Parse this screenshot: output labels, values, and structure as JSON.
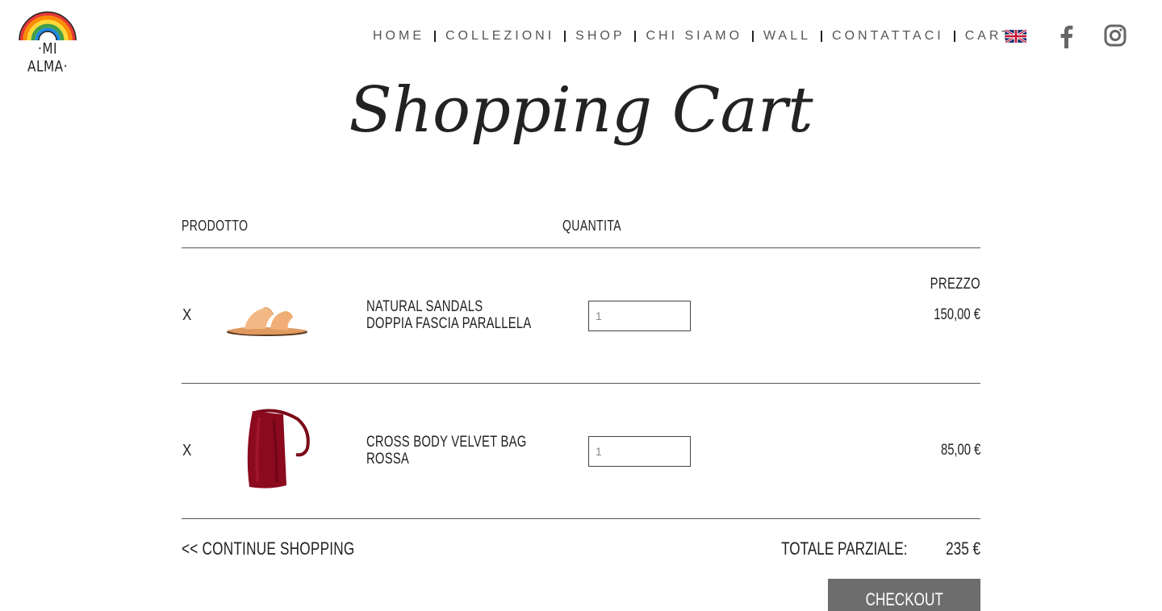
{
  "brand": {
    "name": "·MI ALMA·"
  },
  "nav": {
    "items": [
      "HOME",
      "COLLEZIONI",
      "SHOP",
      "CHI SIAMO",
      "WALL",
      "CONTATTACI",
      "CART"
    ],
    "language_icon": "uk-flag-icon",
    "social_icons": [
      "facebook-icon",
      "instagram-icon"
    ]
  },
  "page_title": "Shopping Cart",
  "table": {
    "headers": {
      "product": "PRODOTTO",
      "quantity": "QUANTITA",
      "price": "PREZZO"
    },
    "rows": [
      {
        "remove": "X",
        "image_icon": "sandal-image",
        "name_line1": "NATURAL SANDALS",
        "name_line2": "DOPPIA FASCIA PARALLELA",
        "quantity": "1",
        "price": "150,00 €"
      },
      {
        "remove": "X",
        "image_icon": "velvet-bag-image",
        "name_line1": "CROSS BODY VELVET BAG",
        "name_line2": "ROSSA",
        "quantity": "1",
        "price": "85,00 €"
      }
    ]
  },
  "footer": {
    "continue_label": "<< CONTINUE SHOPPING",
    "subtotal_label": "TOTALE PARZIALE:",
    "subtotal_value": "235 €",
    "checkout_label": "CHECKOUT"
  },
  "colors": {
    "text": "#222222",
    "nav_text": "#555555",
    "checkout_bg": "#6d6d6d",
    "bag_red": "#8b0a1e",
    "sandal_tan": "#f0b080"
  }
}
